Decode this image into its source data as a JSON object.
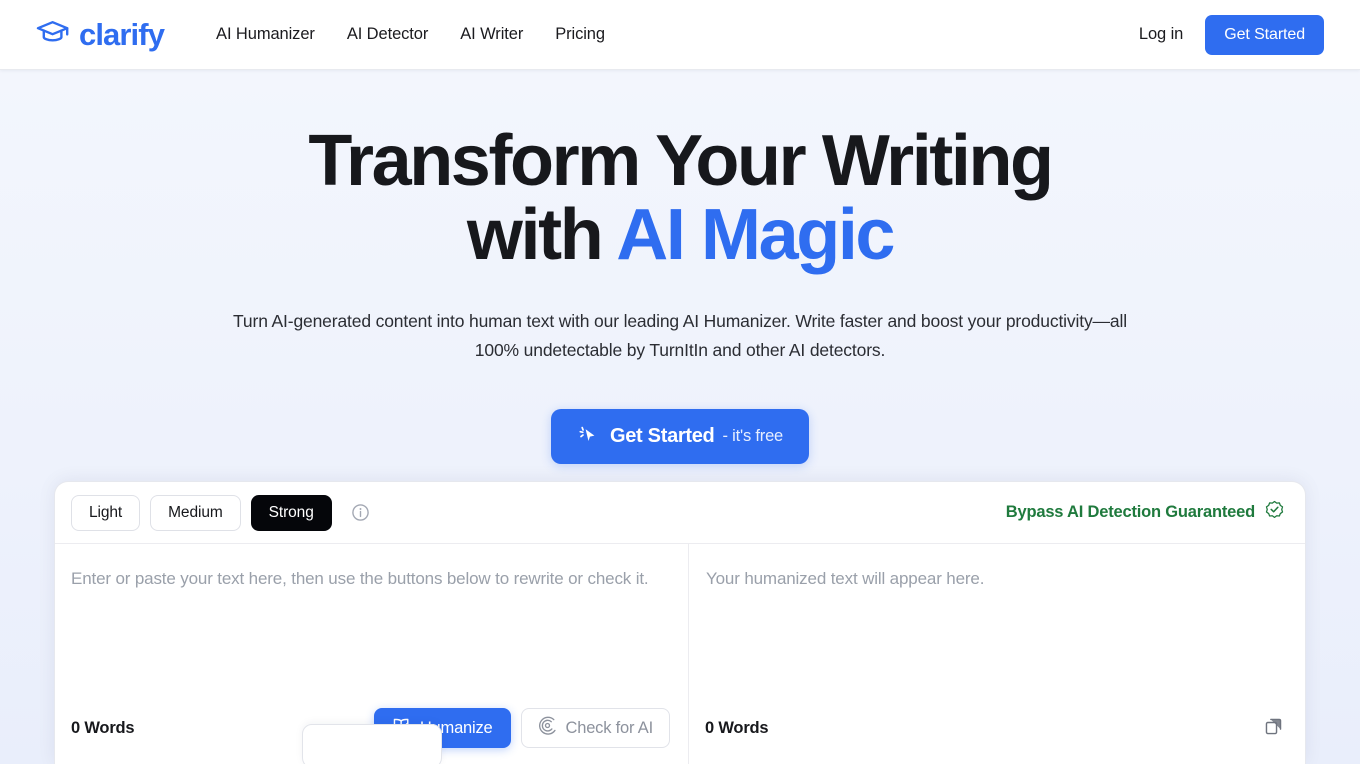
{
  "colors": {
    "brand_blue": "#2f6df0",
    "accent_green": "#1f7a3d",
    "dark": "#05060a",
    "page_bg": "#eef2fc"
  },
  "header": {
    "brand_name": "clarify",
    "brand_icon": "graduation-cap-icon",
    "nav": [
      {
        "label": "AI Humanizer"
      },
      {
        "label": "AI Detector"
      },
      {
        "label": "AI Writer"
      },
      {
        "label": "Pricing"
      }
    ],
    "login_label": "Log in",
    "get_started_label": "Get Started"
  },
  "hero": {
    "title_line1": "Transform Your Writing",
    "title_line2_prefix": "with ",
    "title_line2_accent": "AI Magic",
    "subtitle": "Turn AI-generated content into human text with our leading AI Humanizer. Write faster and boost your productivity—all 100% undetectable by TurnItIn and other AI detectors.",
    "cta_icon": "cursor-sparkle-icon",
    "cta_strong": "Get Started",
    "cta_light": "- it's free"
  },
  "editor": {
    "toolbar": {
      "tones": [
        {
          "label": "Light",
          "selected": false
        },
        {
          "label": "Medium",
          "selected": false
        },
        {
          "label": "Strong",
          "selected": true
        }
      ],
      "info_icon": "info-circle-icon",
      "guarantee_text": "Bypass AI Detection Guaranteed",
      "guarantee_icon": "check-badge-icon"
    },
    "input_pane": {
      "placeholder": "Enter or paste your text here, then use the buttons below to rewrite or check it.",
      "word_count": "0 Words",
      "humanize_label": "Humanize",
      "humanize_icon": "book-check-icon",
      "check_label": "Check for AI",
      "check_icon": "radar-scan-icon"
    },
    "output_pane": {
      "placeholder": "Your humanized text will appear here.",
      "word_count": "0 Words",
      "copy_icon": "copy-icon"
    }
  }
}
